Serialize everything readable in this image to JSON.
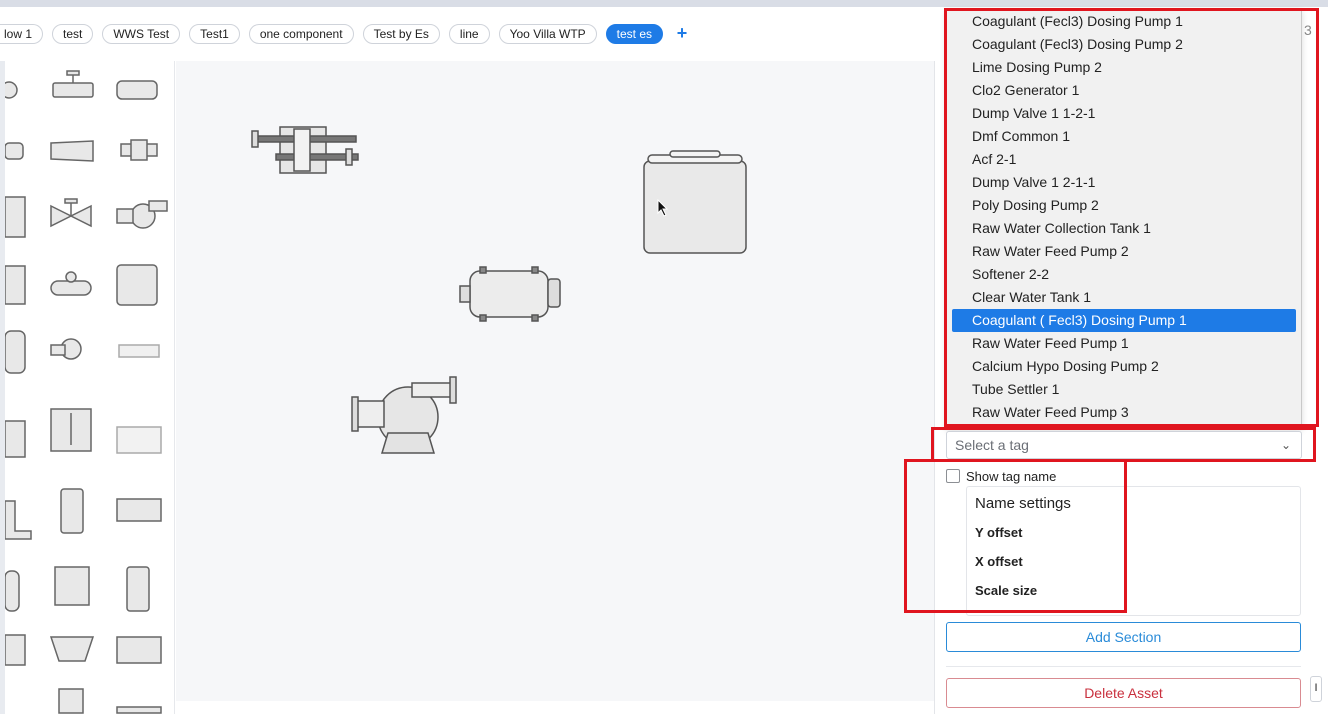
{
  "tabs": [
    {
      "label": "low 1",
      "active": false
    },
    {
      "label": "test",
      "active": false
    },
    {
      "label": "WWS Test",
      "active": false
    },
    {
      "label": "Test1",
      "active": false
    },
    {
      "label": "one component",
      "active": false
    },
    {
      "label": "Test by Es",
      "active": false
    },
    {
      "label": "line",
      "active": false
    },
    {
      "label": "Yoo Villa WTP",
      "active": false
    },
    {
      "label": "test es",
      "active": true
    }
  ],
  "add_tab_icon": "plus-icon",
  "tag_dropdown": {
    "options": [
      "Coagulant (Fecl3) Dosing Pump 1",
      "Coagulant (Fecl3) Dosing Pump 2",
      "Lime Dosing Pump 2",
      "Clo2 Generator 1",
      "Dump Valve 1 1-2-1",
      "Dmf Common 1",
      "Acf 2-1",
      "Dump Valve 1 2-1-1",
      "Poly Dosing Pump 2",
      "Raw Water Collection Tank 1",
      "Raw Water Feed Pump 2",
      "Softener 2-2",
      "Clear Water Tank 1",
      "Coagulant ( Fecl3) Dosing Pump 1",
      "Raw Water Feed Pump 1",
      "Calcium Hypo Dosing Pump 2",
      "Tube Settler 1",
      "Raw Water Feed Pump 3"
    ],
    "selected_index": 13
  },
  "select_tag": {
    "placeholder": "Select a tag",
    "chevron": "chevron-down-icon"
  },
  "show_tag_name": {
    "label": "Show tag name",
    "checked": false
  },
  "name_settings": {
    "title": "Name settings",
    "y_offset_label": "Y offset",
    "x_offset_label": "X offset",
    "scale_size_label": "Scale size"
  },
  "buttons": {
    "add_section": "Add Section",
    "delete_asset": "Delete Asset"
  },
  "colors": {
    "accent": "#1e7be6",
    "highlight_box": "#e0151f",
    "danger": "#c9303e"
  }
}
